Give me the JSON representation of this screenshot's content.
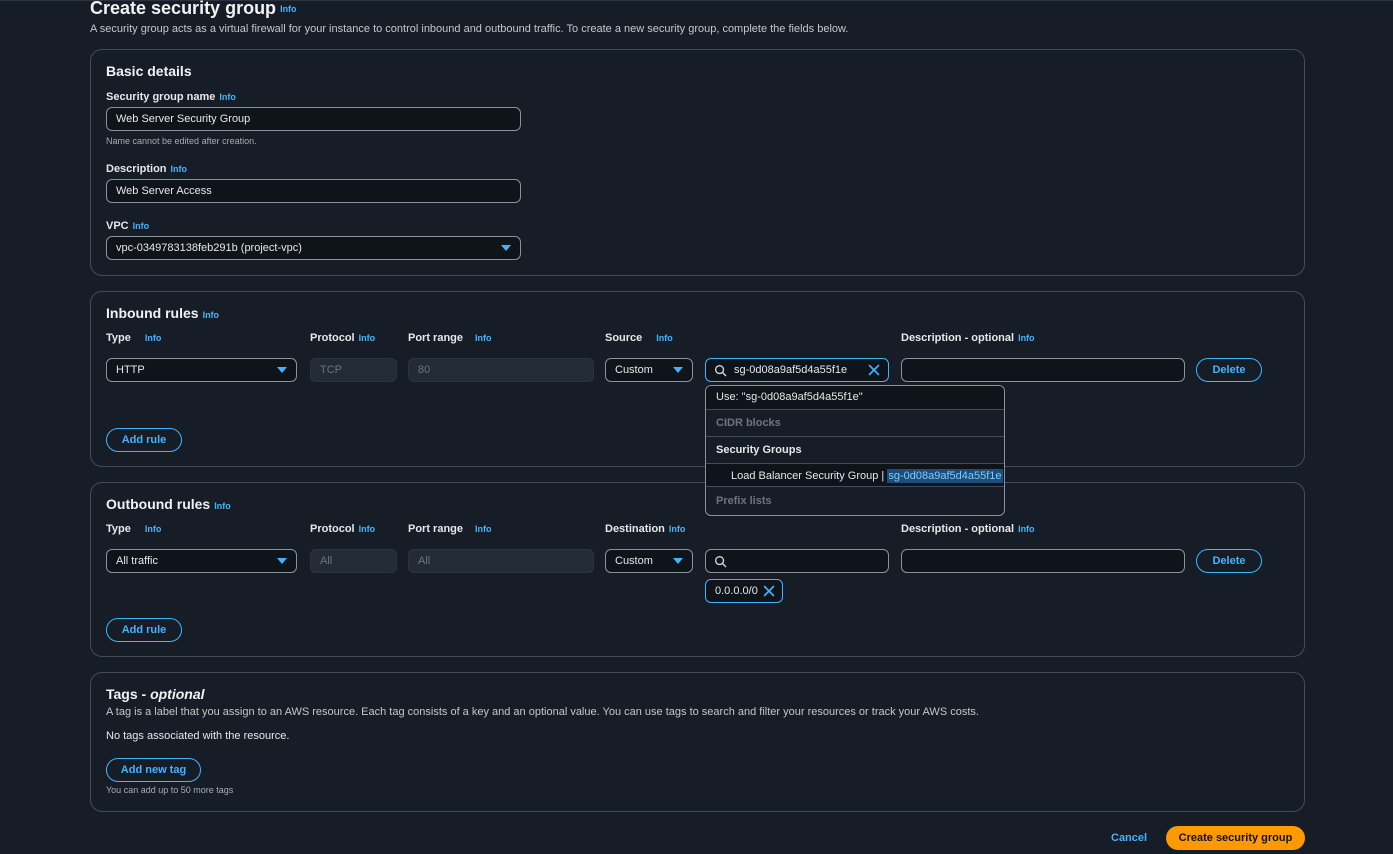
{
  "page": {
    "title": "Create security group",
    "info": "Info",
    "description": "A security group acts as a virtual firewall for your instance to control inbound and outbound traffic. To create a new security group, complete the fields below."
  },
  "basic_details": {
    "title": "Basic details",
    "name_label": "Security group name",
    "name_value": "Web Server Security Group",
    "name_hint": "Name cannot be edited after creation.",
    "desc_label": "Description",
    "desc_value": "Web Server Access",
    "vpc_label": "VPC",
    "vpc_value": "vpc-0349783138feb291b (project-vpc)"
  },
  "inbound": {
    "title": "Inbound rules",
    "col_type": "Type",
    "col_protocol": "Protocol",
    "col_port": "Port range",
    "col_source": "Source",
    "col_desc": "Description - optional",
    "type_value": "HTTP",
    "protocol_value": "TCP",
    "port_value": "80",
    "source_value": "Custom",
    "search_value": "sg-0d08a9af5d4a55f1e",
    "description_value": "",
    "delete_label": "Delete",
    "add_rule_label": "Add rule"
  },
  "dropdown": {
    "use_option": "Use: \"sg-0d08a9af5d4a55f1e\"",
    "cidr_header": "CIDR blocks",
    "sg_header": "Security Groups",
    "sg_option_name": "Load Balancer Security Group | ",
    "sg_option_id": "sg-0d08a9af5d4a55f1e",
    "prefix_header": "Prefix lists"
  },
  "outbound": {
    "title": "Outbound rules",
    "col_type": "Type",
    "col_protocol": "Protocol",
    "col_port": "Port range",
    "col_destination": "Destination",
    "col_desc": "Description - optional",
    "type_value": "All traffic",
    "protocol_value": "All",
    "port_value": "All",
    "destination_value": "Custom",
    "search_value": "",
    "cidr_token": "0.0.0.0/0",
    "description_value": "",
    "delete_label": "Delete",
    "add_rule_label": "Add rule"
  },
  "tags": {
    "title": "Tags - ",
    "title_optional": "optional",
    "description": "A tag is a label that you assign to an AWS resource. Each tag consists of a key and an optional value. You can use tags to search and filter your resources or track your AWS costs.",
    "empty_text": "No tags associated with the resource.",
    "add_tag_label": "Add new tag",
    "limit_hint": "You can add up to 50 more tags"
  },
  "footer": {
    "cancel_label": "Cancel",
    "create_label": "Create security group"
  },
  "colors": {
    "background": "#161d26",
    "accent": "#42b4ff",
    "primary_button": "#ff9900",
    "border": "#414d5c"
  }
}
